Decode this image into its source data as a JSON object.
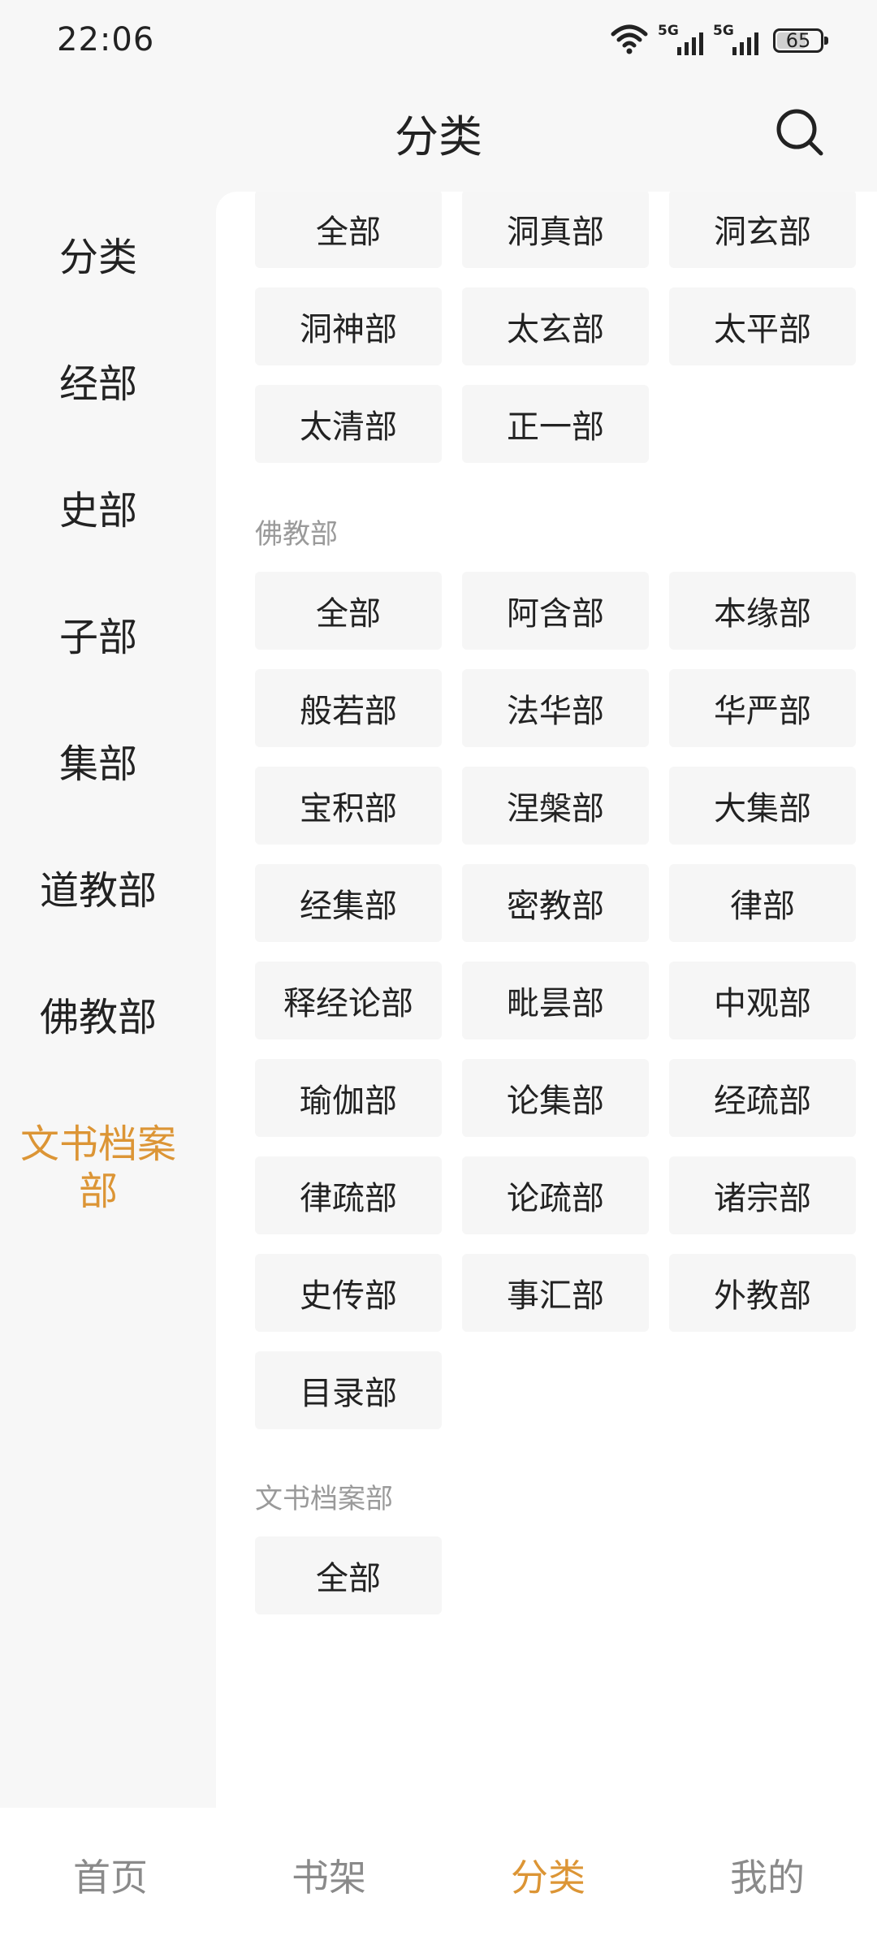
{
  "status_bar": {
    "time": "22:06",
    "network_1": "5G",
    "network_2": "5G",
    "battery_level": "65"
  },
  "header": {
    "title": "分类"
  },
  "sidebar": {
    "items": [
      {
        "label": "分类"
      },
      {
        "label": "经部"
      },
      {
        "label": "史部"
      },
      {
        "label": "子部"
      },
      {
        "label": "集部"
      },
      {
        "label": "道教部"
      },
      {
        "label": "佛教部"
      },
      {
        "label": "文书档案\n部"
      }
    ],
    "active_index": 7
  },
  "content": {
    "taoism_items": [
      "全部",
      "洞真部",
      "洞玄部",
      "洞神部",
      "太玄部",
      "太平部",
      "太清部",
      "正一部"
    ],
    "buddhism": {
      "title": "佛教部",
      "items": [
        "全部",
        "阿含部",
        "本缘部",
        "般若部",
        "法华部",
        "华严部",
        "宝积部",
        "涅槃部",
        "大集部",
        "经集部",
        "密教部",
        "律部",
        "释经论部",
        "毗昙部",
        "中观部",
        "瑜伽部",
        "论集部",
        "经疏部",
        "律疏部",
        "论疏部",
        "诸宗部",
        "史传部",
        "事汇部",
        "外教部",
        "目录部"
      ]
    },
    "archives": {
      "title": "文书档案部",
      "items": [
        "全部"
      ]
    }
  },
  "bottom_nav": {
    "items": [
      {
        "label": "首页"
      },
      {
        "label": "书架"
      },
      {
        "label": "分类"
      },
      {
        "label": "我的"
      }
    ],
    "active_index": 2
  },
  "colors": {
    "accent": "#dc9535",
    "chip_bg": "#f6f6f6",
    "section_title": "#9a9a9a"
  }
}
